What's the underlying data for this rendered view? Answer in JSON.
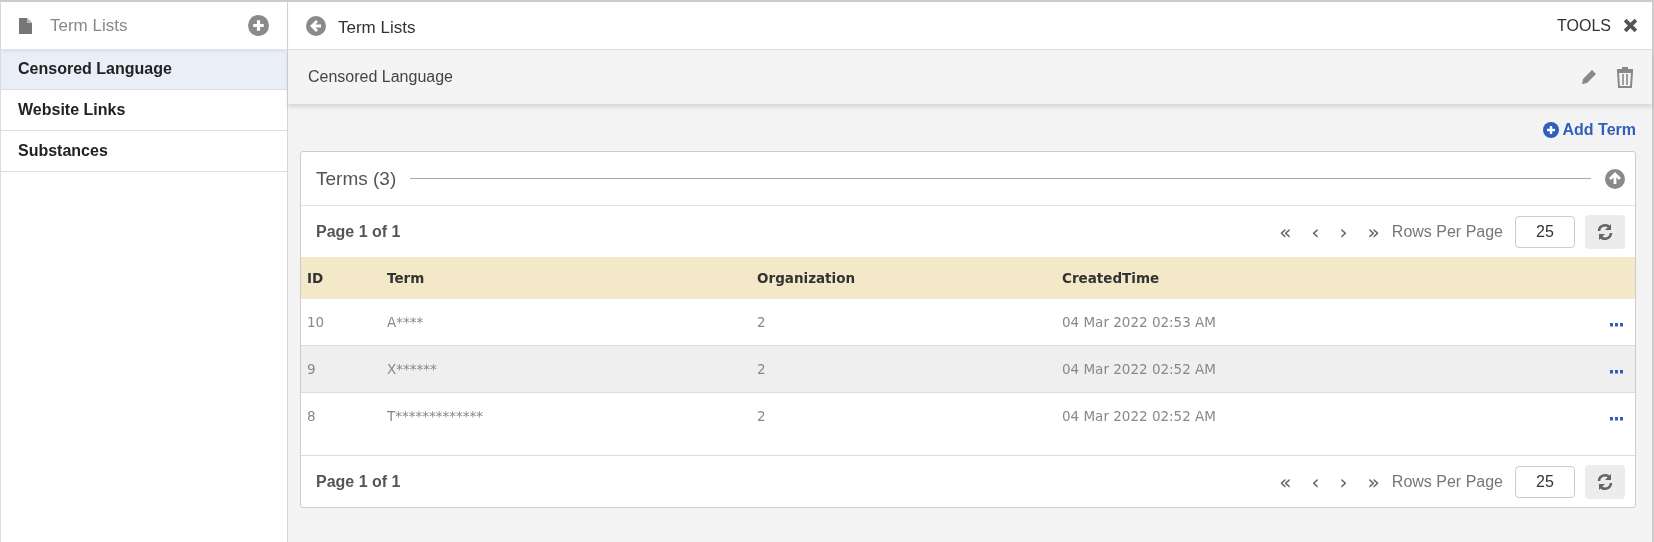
{
  "sidebar": {
    "title": "Term Lists",
    "items": [
      {
        "label": "Censored Language",
        "selected": true
      },
      {
        "label": "Website Links",
        "selected": false
      },
      {
        "label": "Substances",
        "selected": false
      }
    ]
  },
  "header": {
    "back_label": "Term Lists",
    "tools_label": "TOOLS"
  },
  "list_title": "Censored Language",
  "add_term": "Add Term",
  "terms_panel": {
    "title": "Terms (3)",
    "pager_top": {
      "page_info": "Page 1 of 1",
      "first": "«",
      "prev": "‹",
      "next": "›",
      "last": "»",
      "rows_per_page_label": "Rows Per Page",
      "rows_per_page": "25"
    },
    "columns": [
      "ID",
      "Term",
      "Organization",
      "CreatedTime"
    ],
    "rows": [
      {
        "id": "10",
        "term": "A****",
        "organization": "2",
        "created": "04 Mar 2022 02:53 AM"
      },
      {
        "id": "9",
        "term": "X******",
        "organization": "2",
        "created": "04 Mar 2022 02:52 AM"
      },
      {
        "id": "8",
        "term": "T*************",
        "organization": "2",
        "created": "04 Mar 2022 02:52 AM"
      }
    ],
    "pager_bottom": {
      "page_info": "Page 1 of 1",
      "first": "«",
      "prev": "‹",
      "next": "›",
      "last": "»",
      "rows_per_page_label": "Rows Per Page",
      "rows_per_page": "25"
    }
  }
}
